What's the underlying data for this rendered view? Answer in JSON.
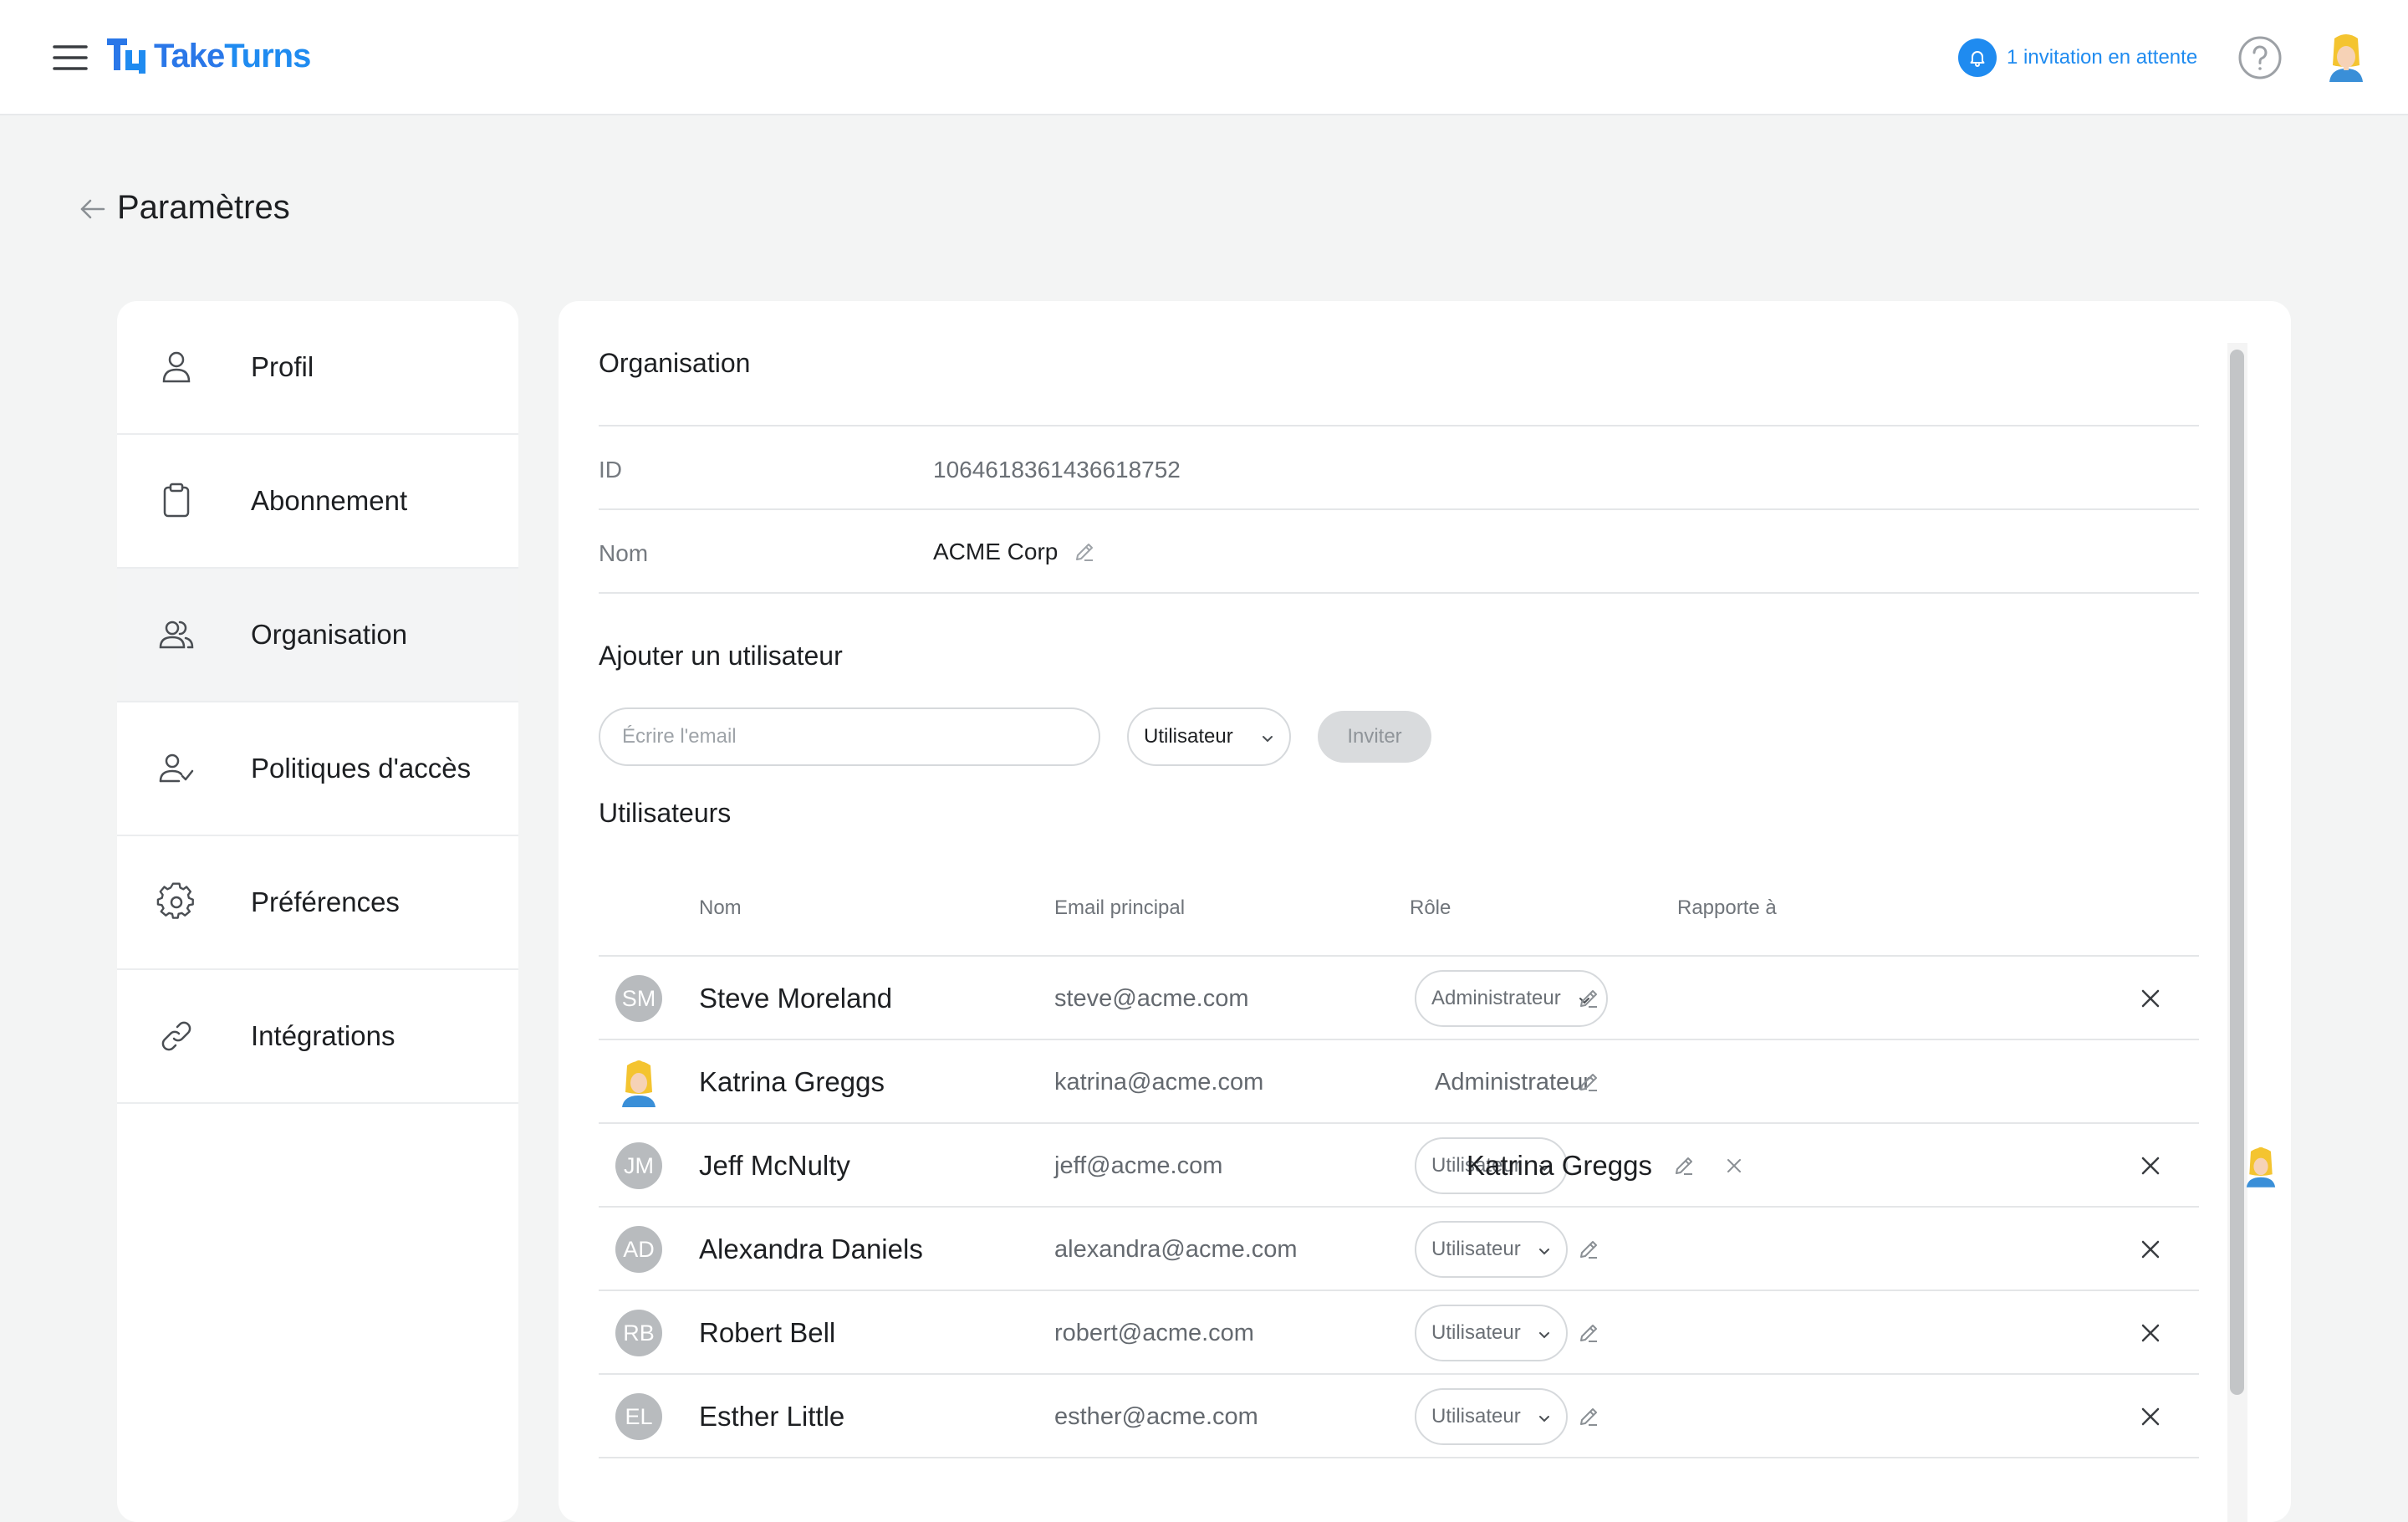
{
  "app": {
    "logo_take": "Take",
    "logo_turns": "Turns",
    "invitation_label": "1 invitation en attente",
    "brand_color": "#1f8bf0"
  },
  "page": {
    "title": "Paramètres"
  },
  "sidebar": {
    "items": [
      {
        "label": "Profil",
        "icon": "user-icon"
      },
      {
        "label": "Abonnement",
        "icon": "clipboard-icon"
      },
      {
        "label": "Organisation",
        "icon": "users-icon",
        "active": true
      },
      {
        "label": "Politiques d'accès",
        "icon": "user-check-icon"
      },
      {
        "label": "Préférences",
        "icon": "gear-icon"
      },
      {
        "label": "Intégrations",
        "icon": "link-icon"
      }
    ]
  },
  "org": {
    "section_title": "Organisation",
    "id_label": "ID",
    "id_value": "1064618361436618752",
    "name_label": "Nom",
    "name_value": "ACME Corp"
  },
  "add_user": {
    "title": "Ajouter un utilisateur",
    "email_placeholder": "Écrire l'email",
    "role_value": "Utilisateur",
    "invite_label": "Inviter"
  },
  "users": {
    "title": "Utilisateurs",
    "headers": {
      "name": "Nom",
      "email": "Email principal",
      "role": "Rôle",
      "reports_to": "Rapporte à"
    },
    "rows": [
      {
        "initials": "SM",
        "name": "Steve Moreland",
        "email": "steve@acme.com",
        "role": "Administrateur",
        "reports_to": ""
      },
      {
        "initials": "",
        "name": "Katrina Greggs",
        "email": "katrina@acme.com",
        "role": "Administrateur",
        "reports_to": ""
      },
      {
        "initials": "JM",
        "name": "Jeff McNulty",
        "email": "jeff@acme.com",
        "role": "Utilisateur",
        "reports_to": "Katrina Greggs"
      },
      {
        "initials": "AD",
        "name": "Alexandra Daniels",
        "email": "alexandra@acme.com",
        "role": "Utilisateur",
        "reports_to": ""
      },
      {
        "initials": "RB",
        "name": "Robert Bell",
        "email": "robert@acme.com",
        "role": "Utilisateur",
        "reports_to": ""
      },
      {
        "initials": "EL",
        "name": "Esther Little",
        "email": "esther@acme.com",
        "role": "Utilisateur",
        "reports_to": ""
      }
    ]
  }
}
